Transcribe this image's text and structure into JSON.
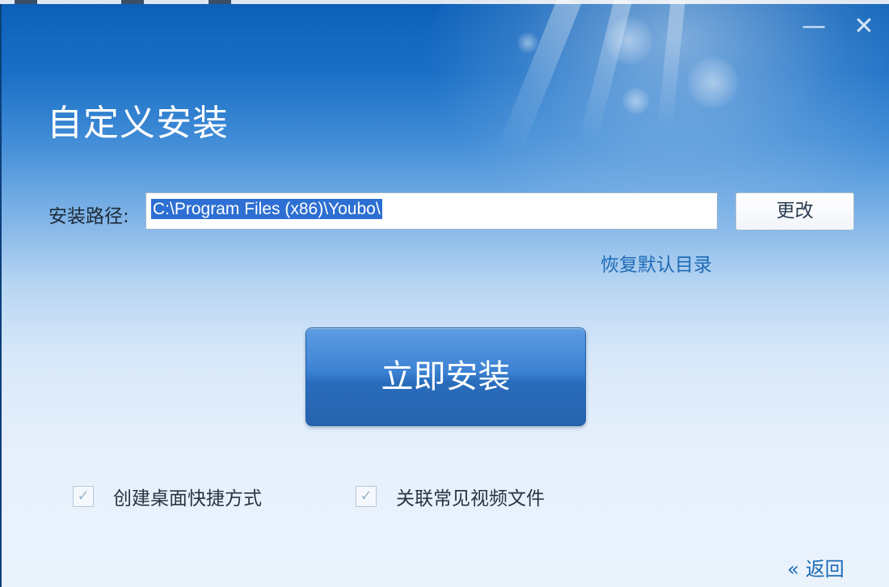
{
  "window": {
    "title": "自定义安装",
    "minimize_glyph": "—",
    "close_glyph": "✕"
  },
  "path": {
    "label": "安装路径:",
    "value": "C:\\Program Files (x86)\\Youbo\\",
    "change_label": "更改",
    "restore_label": "恢复默认目录"
  },
  "install": {
    "label": "立即安装"
  },
  "options": [
    {
      "label": "创建桌面快捷方式",
      "checked": true
    },
    {
      "label": "关联常见视频文件",
      "checked": true
    }
  ],
  "footer": {
    "back_icon": "«",
    "back_label": "返回"
  },
  "colors": {
    "accent": "#1e6bb6",
    "button": "#2a6dbd",
    "header": "#0b5fb8"
  }
}
